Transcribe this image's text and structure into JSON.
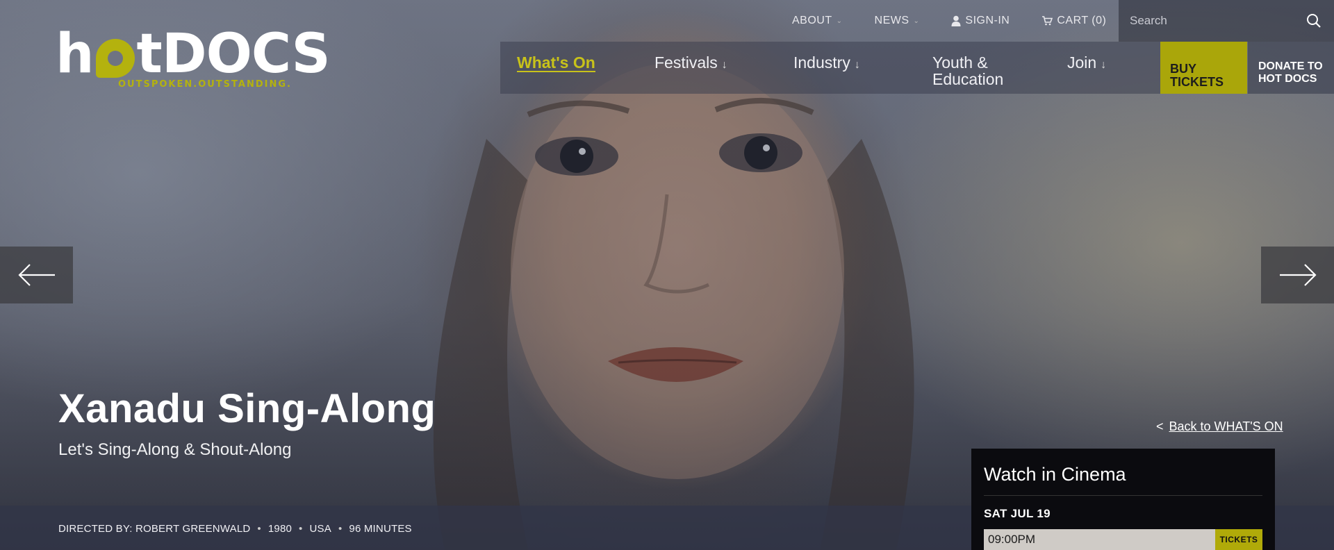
{
  "brand": {
    "logo_text_before": "h",
    "logo_text_after": "tDOCS",
    "tagline": "OUTSPOKEN.OUTSTANDING.",
    "accent_color": "#b4b20e"
  },
  "utility": {
    "about": "ABOUT",
    "news": "NEWS",
    "sign_in": "SIGN-IN",
    "cart": "CART (0)",
    "search_placeholder": "Search"
  },
  "nav": {
    "whats_on": "What's On",
    "festivals": "Festivals",
    "industry": "Industry",
    "youth_line1": "Youth &",
    "youth_line2": "Education",
    "join": "Join",
    "arrow": "↓"
  },
  "cta": {
    "buy_line1": "BUY",
    "buy_line2": "TICKETS",
    "donate_line1": "DONATE TO",
    "donate_line2": "HOT DOCS"
  },
  "film": {
    "title": "Xanadu Sing-Along",
    "subtitle": "Let's Sing-Along & Shout-Along",
    "credits": {
      "director": "DIRECTED BY: ROBERT GREENWALD",
      "year": "1980",
      "country": "USA",
      "runtime": "96 MINUTES",
      "separator": "•"
    }
  },
  "back": {
    "chevron": "<",
    "label": "Back to WHAT'S ON"
  },
  "cinema": {
    "title": "Watch in Cinema",
    "date": "SAT JUL 19",
    "time": "09:00PM",
    "tickets_label": "TICKETS"
  },
  "icons": {
    "caret": "⌄",
    "user": "user-icon",
    "cart": "cart-icon",
    "search": "search-icon",
    "prev": "arrow-left-icon",
    "next": "arrow-right-icon"
  }
}
